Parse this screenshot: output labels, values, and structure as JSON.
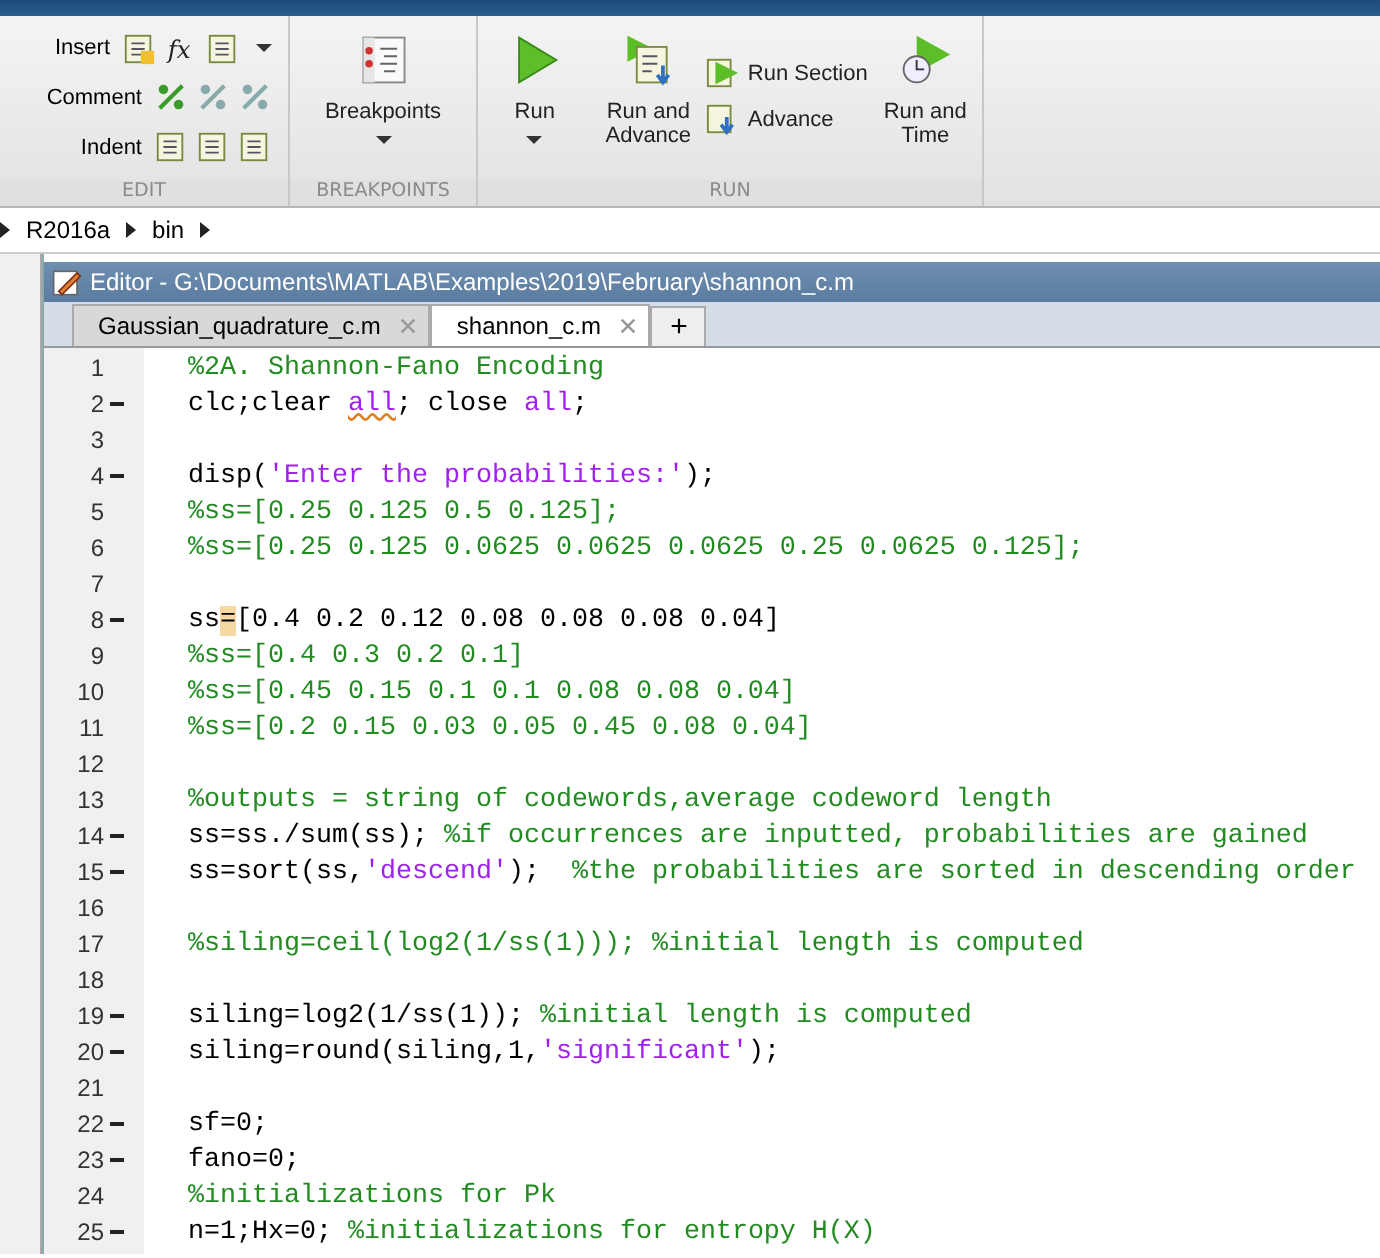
{
  "ribbon": {
    "sections": [
      {
        "kind": "edit",
        "title": "EDIT",
        "rows": [
          {
            "label": "Insert",
            "glyph": "fx"
          },
          {
            "label": "Comment"
          },
          {
            "label": "Indent"
          }
        ]
      },
      {
        "kind": "breakpoints",
        "title": "BREAKPOINTS",
        "buttons": [
          {
            "label": "Breakpoints",
            "dropdown": true
          }
        ]
      },
      {
        "kind": "run",
        "title": "RUN",
        "buttons": [
          {
            "kind": "run",
            "label": "Run",
            "dropdown": true
          },
          {
            "kind": "run-advance",
            "label": "Run and Advance",
            "dropdown": false
          },
          {
            "kind": "stack",
            "items": [
              "Run Section",
              "Advance"
            ]
          },
          {
            "kind": "run-time",
            "label": "Run and Time",
            "dropdown": false
          }
        ]
      }
    ]
  },
  "breadcrumb": [
    "R2016a",
    "bin"
  ],
  "editor": {
    "title": "Editor - G:\\Documents\\MATLAB\\Examples\\2019\\February\\shannon_c.m",
    "tabs": [
      {
        "label": "Gaussian_quadrature_c.m",
        "selected": false
      },
      {
        "label": "shannon_c.m",
        "selected": true
      }
    ],
    "new_tab": "+",
    "lines": [
      {
        "number": "1",
        "executable": false,
        "segments": [
          {
            "kind": "comment",
            "text": "%2A. Shannon-Fano Encoding"
          }
        ]
      },
      {
        "number": "2",
        "executable": true,
        "segments": [
          {
            "kind": "plain",
            "text": "clc;clear "
          },
          {
            "kind": "keyword",
            "text": "all",
            "warning": true
          },
          {
            "kind": "plain",
            "text": "; close "
          },
          {
            "kind": "keyword",
            "text": "all"
          },
          {
            "kind": "plain",
            "text": ";"
          }
        ]
      },
      {
        "number": "3",
        "executable": false
      },
      {
        "number": "4",
        "executable": true,
        "segments": [
          {
            "kind": "plain",
            "text": "disp("
          },
          {
            "kind": "string",
            "text": "'Enter the probabilities:'"
          },
          {
            "kind": "plain",
            "text": ");"
          }
        ]
      },
      {
        "number": "5",
        "executable": false,
        "segments": [
          {
            "kind": "comment",
            "text": "%ss=[0.25 0.125 0.5 0.125];"
          }
        ]
      },
      {
        "number": "6",
        "executable": false,
        "segments": [
          {
            "kind": "comment",
            "text": "%ss=[0.25 0.125 0.0625 0.0625 0.0625 0.25 0.0625 0.125];"
          }
        ]
      },
      {
        "number": "7",
        "executable": false
      },
      {
        "number": "8",
        "executable": true,
        "segments": [
          {
            "kind": "plain",
            "text": "ss"
          },
          {
            "kind": "plain",
            "text": "=",
            "highlight": true
          },
          {
            "kind": "plain",
            "text": "[0.4 0.2 0.12 0.08 0.08 0.08 0.04]"
          }
        ]
      },
      {
        "number": "9",
        "executable": false,
        "segments": [
          {
            "kind": "comment",
            "text": "%ss=[0.4 0.3 0.2 0.1]"
          }
        ]
      },
      {
        "number": "10",
        "executable": false,
        "segments": [
          {
            "kind": "comment",
            "text": "%ss=[0.45 0.15 0.1 0.1 0.08 0.08 0.04]"
          }
        ]
      },
      {
        "number": "11",
        "executable": false,
        "segments": [
          {
            "kind": "comment",
            "text": "%ss=[0.2 0.15 0.03 0.05 0.45 0.08 0.04]"
          }
        ]
      },
      {
        "number": "12",
        "executable": false
      },
      {
        "number": "13",
        "executable": false,
        "segments": [
          {
            "kind": "comment",
            "text": "%outputs = string of codewords,average codeword length"
          }
        ]
      },
      {
        "number": "14",
        "executable": true,
        "segments": [
          {
            "kind": "plain",
            "text": "ss=ss./sum(ss); "
          },
          {
            "kind": "comment",
            "text": "%if occurrences are inputted, probabilities are gained"
          }
        ]
      },
      {
        "number": "15",
        "executable": true,
        "segments": [
          {
            "kind": "plain",
            "text": "ss=sort(ss,"
          },
          {
            "kind": "string",
            "text": "'descend'"
          },
          {
            "kind": "plain",
            "text": ");  "
          },
          {
            "kind": "comment",
            "text": "%the probabilities are sorted in descending order"
          }
        ]
      },
      {
        "number": "16",
        "executable": false
      },
      {
        "number": "17",
        "executable": false,
        "segments": [
          {
            "kind": "comment",
            "text": "%siling=ceil(log2(1/ss(1))); %initial length is computed"
          }
        ]
      },
      {
        "number": "18",
        "executable": false
      },
      {
        "number": "19",
        "executable": true,
        "segments": [
          {
            "kind": "plain",
            "text": "siling=log2(1/ss(1)); "
          },
          {
            "kind": "comment",
            "text": "%initial length is computed"
          }
        ]
      },
      {
        "number": "20",
        "executable": true,
        "segments": [
          {
            "kind": "plain",
            "text": "siling=round(siling,1,"
          },
          {
            "kind": "string",
            "text": "'significant'"
          },
          {
            "kind": "plain",
            "text": ");"
          }
        ]
      },
      {
        "number": "21",
        "executable": false
      },
      {
        "number": "22",
        "executable": true,
        "segments": [
          {
            "kind": "plain",
            "text": "sf=0;"
          }
        ]
      },
      {
        "number": "23",
        "executable": true,
        "segments": [
          {
            "kind": "plain",
            "text": "fano=0;"
          }
        ]
      },
      {
        "number": "24",
        "executable": false,
        "segments": [
          {
            "kind": "comment",
            "text": "%initializations for Pk"
          }
        ]
      },
      {
        "number": "25",
        "executable": true,
        "segments": [
          {
            "kind": "plain",
            "text": "n=1;Hx=0; "
          },
          {
            "kind": "comment",
            "text": "%initializations for entropy H(X)"
          }
        ]
      }
    ]
  }
}
